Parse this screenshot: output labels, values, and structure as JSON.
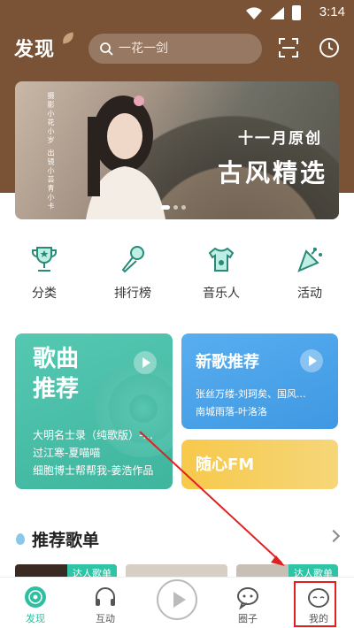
{
  "status_bar": {
    "time": "3:14"
  },
  "header": {
    "title": "发现",
    "search_placeholder": "一花一剑"
  },
  "banner": {
    "subtitle": "十一月原创",
    "title": "古风精选",
    "side_text": "摄影小花小岁 出镜小芸青小卡"
  },
  "quick_links": [
    {
      "label": "分类"
    },
    {
      "label": "排行榜"
    },
    {
      "label": "音乐人"
    },
    {
      "label": "活动"
    }
  ],
  "song_card": {
    "title_line1": "歌曲",
    "title_line2": "推荐",
    "items": [
      "大明名士录（纯歌版）-...",
      "过江寒-夏喵喵",
      "细胞博士帮帮我-姜浩作品"
    ]
  },
  "new_card": {
    "title": "新歌推荐",
    "items": [
      "张丝万缕-刘珂矣、国风...",
      "南城雨落-叶洛洛"
    ]
  },
  "fm_card": {
    "title": "随心FM"
  },
  "section": {
    "title": "推荐歌单"
  },
  "playlist_tags": [
    "达人歌单",
    "达人歌单"
  ],
  "tabbar": {
    "items": [
      {
        "label": "发现",
        "active": true
      },
      {
        "label": "互动",
        "active": false
      },
      {
        "label": "圈子",
        "active": false
      },
      {
        "label": "我的",
        "active": false
      }
    ]
  },
  "colors": {
    "brand_brown": "#7a5236",
    "accent_green": "#2ebfa0",
    "annotation_red": "#e02020"
  }
}
